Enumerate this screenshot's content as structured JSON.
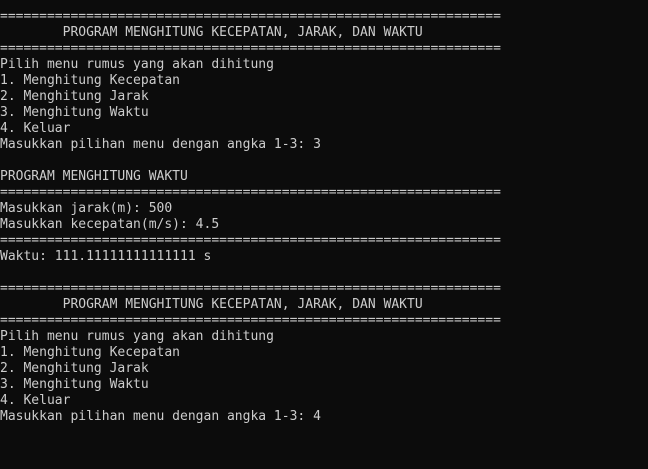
{
  "console": {
    "lines": [
      "================================================================",
      "        PROGRAM MENGHITUNG KECEPATAN, JARAK, DAN WAKTU",
      "================================================================",
      "Pilih menu rumus yang akan dihitung",
      "1. Menghitung Kecepatan",
      "2. Menghitung Jarak",
      "3. Menghitung Waktu",
      "4. Keluar",
      "Masukkan pilihan menu dengan angka 1-3: 3",
      "",
      "PROGRAM MENGHITUNG WAKTU",
      "================================================================",
      "Masukkan jarak(m): 500",
      "Masukkan kecepatan(m/s): 4.5",
      "================================================================",
      "Waktu: 111.11111111111111 s",
      "",
      "================================================================",
      "        PROGRAM MENGHITUNG KECEPATAN, JARAK, DAN WAKTU",
      "================================================================",
      "Pilih menu rumus yang akan dihitung",
      "1. Menghitung Kecepatan",
      "2. Menghitung Jarak",
      "3. Menghitung Waktu",
      "4. Keluar",
      "Masukkan pilihan menu dengan angka 1-3: 4"
    ]
  },
  "colors": {
    "background": "#0c0c0c",
    "text": "#cccccc"
  }
}
